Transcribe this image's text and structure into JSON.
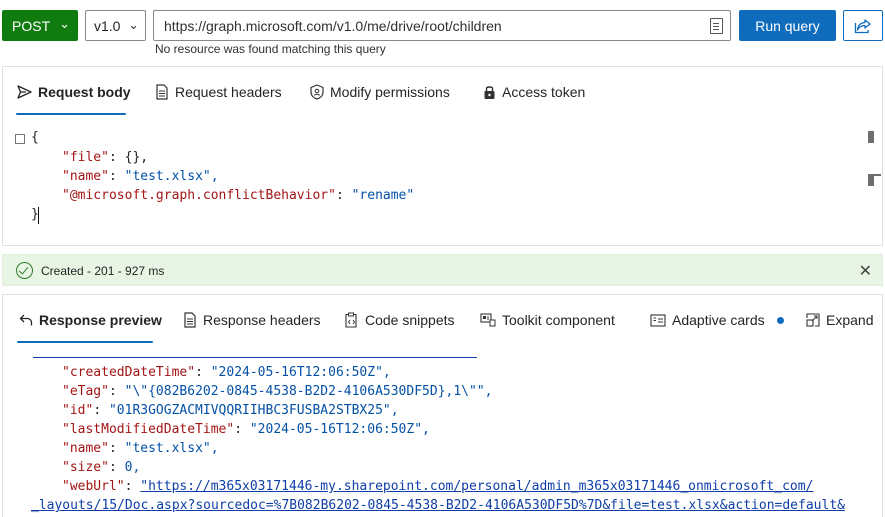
{
  "toolbar": {
    "method": "POST",
    "version": "v1.0",
    "url": "https://graph.microsoft.com/v1.0/me/drive/root/children",
    "url_message": "No resource was found matching this query",
    "run_label": "Run query"
  },
  "request_tabs": [
    {
      "label": "Request body",
      "icon": "send-icon"
    },
    {
      "label": "Request headers",
      "icon": "document-icon"
    },
    {
      "label": "Modify permissions",
      "icon": "shield-icon"
    },
    {
      "label": "Access token",
      "icon": "lock-icon"
    }
  ],
  "request_body": {
    "open": "{",
    "lines": [
      {
        "key": "\"file\"",
        "value": "{},"
      },
      {
        "key": "\"name\"",
        "value": "\"test.xlsx\","
      },
      {
        "key": "\"@microsoft.graph.conflictBehavior\"",
        "value": "\"rename\""
      }
    ],
    "close": "}"
  },
  "status": {
    "text": "Created - 201 - 927 ms",
    "color": "#e8f5e4"
  },
  "response_tabs": [
    {
      "label": "Response preview",
      "icon": "undo-arrow-icon"
    },
    {
      "label": "Response headers",
      "icon": "document-icon"
    },
    {
      "label": "Code snippets",
      "icon": "clipboard-code-icon"
    },
    {
      "label": "Toolkit component",
      "icon": "toolkit-icon"
    },
    {
      "label": "Adaptive cards",
      "icon": "card-icon"
    },
    {
      "label": "Expand",
      "icon": "expand-icon"
    }
  ],
  "response_body": {
    "lines": [
      {
        "key": "\"createdDateTime\"",
        "value": "\"2024-05-16T12:06:50Z\","
      },
      {
        "key": "\"eTag\"",
        "value": "\"\\\"{082B6202-0845-4538-B2D2-4106A530DF5D},1\\\"\","
      },
      {
        "key": "\"id\"",
        "value": "\"01R3GOGZACMIVQQRIIHBC3FUSBA2STBX25\","
      },
      {
        "key": "\"lastModifiedDateTime\"",
        "value": "\"2024-05-16T12:06:50Z\","
      },
      {
        "key": "\"name\"",
        "value": "\"test.xlsx\","
      },
      {
        "key": "\"size\"",
        "value": "0,"
      }
    ],
    "weburl_key": "\"webUrl\"",
    "weburl_line1": "\"https://m365x03171446-my.sharepoint.com/personal/admin_m365x03171446_onmicrosoft_com/",
    "weburl_line2": "_layouts/15/Doc.aspx?sourcedoc=%7B082B6202-0845-4538-B2D2-4106A530DF5D%7D&file=test.xlsx&action=default&"
  },
  "colors": {
    "method_bg": "#107c10",
    "accent": "#0f6cbd"
  }
}
